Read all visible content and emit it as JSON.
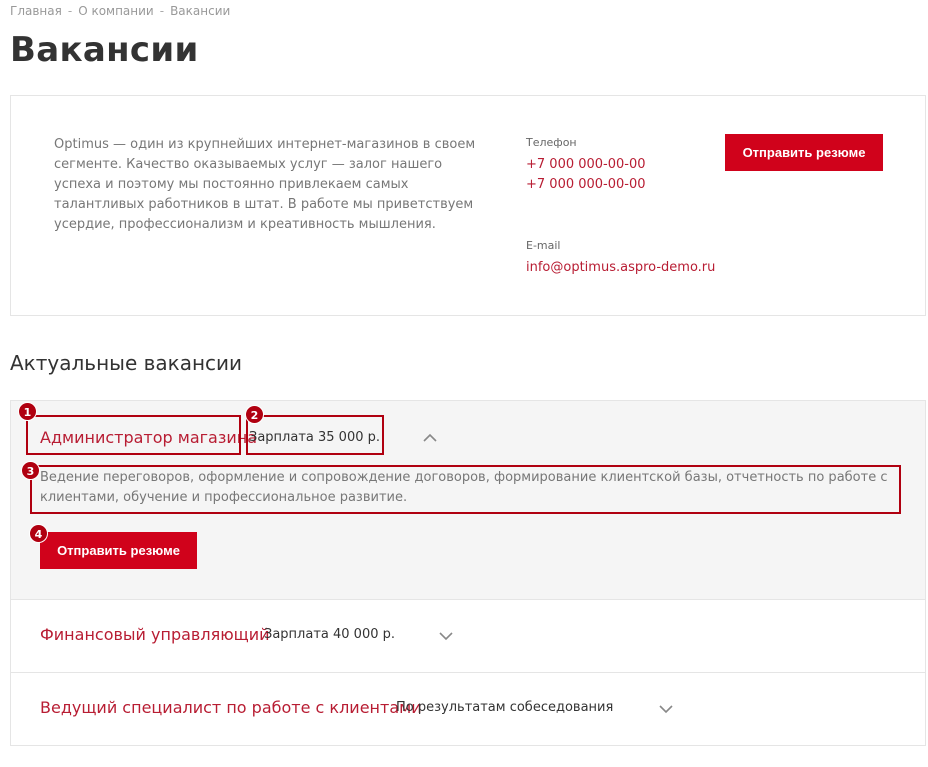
{
  "breadcrumb": {
    "items": [
      "Главная",
      "О компании",
      "Вакансии"
    ],
    "separator": "-"
  },
  "page": {
    "title": "Вакансии"
  },
  "info": {
    "intro": "Optimus — один из крупнейших интернет-магазинов в своем сегменте. Качество оказываемых услуг — залог нашего успеха и поэтому мы постоянно привлекаем самых талантливых работников в штат. В работе мы приветствуем усердие, профессионализм и креативность мышления.",
    "phone_label": "Телефон",
    "phones": [
      "+7 000 000-00-00",
      "+7 000 000-00-00"
    ],
    "email_label": "E-mail",
    "email": "info@optimus.aspro-demo.ru",
    "send_button": "Отправить резюме"
  },
  "section": {
    "title": "Актуальные вакансии"
  },
  "vacancies": [
    {
      "title": "Администратор магазина",
      "salary": "Зарплата 35 000 р.",
      "expanded": true,
      "description": "Ведение переговоров, оформление и сопровождение договоров, формирование клиентской базы, отчетность по работе с клиентами, обучение и профессиональное развитие.",
      "button": "Отправить резюме"
    },
    {
      "title": "Финансовый управляющий",
      "salary": "Зарплата 40 000 р.",
      "expanded": false
    },
    {
      "title": "Ведущий специалист по работе с клиентами",
      "salary": "По результатам собеседования",
      "expanded": false
    }
  ],
  "markers": [
    "1",
    "2",
    "3",
    "4"
  ],
  "colors": {
    "accent": "#d0021b",
    "link": "#b81d33",
    "marker": "#b00010"
  },
  "icons": {
    "expanded": "chevron-up-icon",
    "collapsed": "chevron-down-icon"
  }
}
